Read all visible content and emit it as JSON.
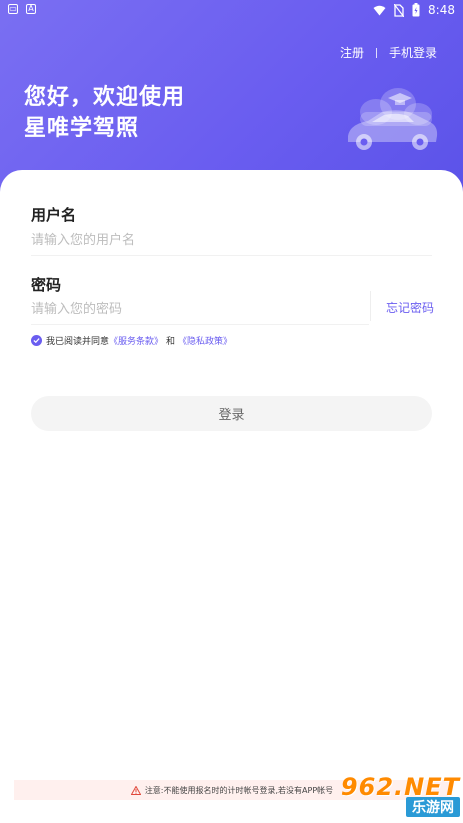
{
  "status_bar": {
    "time": "8:48",
    "left_icons": [
      "keyboard-icon",
      "font-icon"
    ],
    "right_icons": [
      "wifi-icon",
      "no-sim-icon",
      "battery-icon"
    ]
  },
  "header": {
    "register_link": "注册",
    "phone_login_link": "手机登录",
    "welcome_line1": "您好，欢迎使用",
    "welcome_line2": "星唯学驾照"
  },
  "form": {
    "username_label": "用户名",
    "username_placeholder": "请输入您的用户名",
    "username_value": "",
    "password_label": "密码",
    "password_placeholder": "请输入您的密码",
    "password_value": "",
    "forgot_password": "忘记密码",
    "agree_prefix": "我已阅读并同意",
    "terms_link": "《服务条款》",
    "and_text": "和",
    "privacy_link": "《隐私政策》",
    "agree_checked": true,
    "login_button": "登录"
  },
  "footer": {
    "notice_text": "注意:不能使用报名时的计时帐号登录,若没有APP帐号"
  },
  "watermark": {
    "top": "962.NET",
    "bottom": "乐游网"
  },
  "colors": {
    "accent": "#6a5df0",
    "hero_gradient_start": "#7a6ff2",
    "hero_gradient_end": "#5a52e8",
    "watermark_orange": "#ff8a00",
    "watermark_blue": "#2a9ad6"
  }
}
